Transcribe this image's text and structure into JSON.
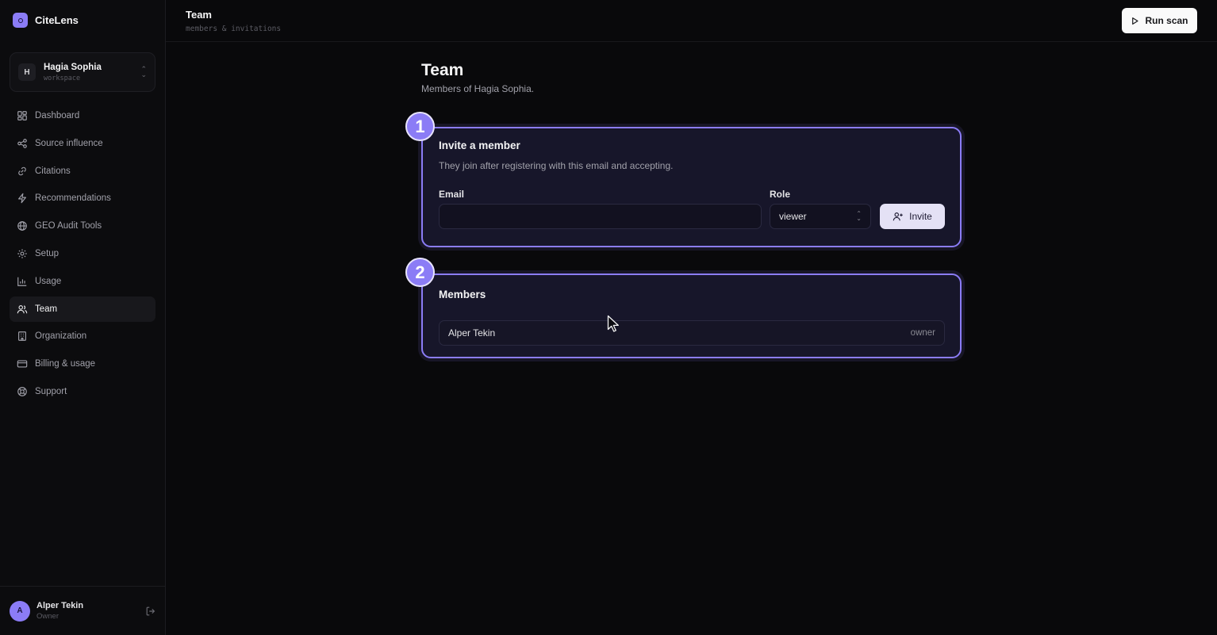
{
  "brand": {
    "name": "CiteLens"
  },
  "workspace": {
    "initial": "H",
    "name": "Hagia Sophia",
    "label": "workspace"
  },
  "nav": [
    {
      "label": "Dashboard",
      "icon": "dashboard-icon"
    },
    {
      "label": "Source influence",
      "icon": "share-nodes-icon"
    },
    {
      "label": "Citations",
      "icon": "link-icon"
    },
    {
      "label": "Recommendations",
      "icon": "lightning-icon"
    },
    {
      "label": "GEO Audit Tools",
      "icon": "globe-icon"
    },
    {
      "label": "Setup",
      "icon": "gear-icon"
    },
    {
      "label": "Usage",
      "icon": "bar-chart-icon"
    },
    {
      "label": "Team",
      "icon": "users-icon",
      "active": true
    },
    {
      "label": "Organization",
      "icon": "building-icon"
    },
    {
      "label": "Billing & usage",
      "icon": "credit-card-icon"
    },
    {
      "label": "Support",
      "icon": "lifebuoy-icon"
    }
  ],
  "user": {
    "initial": "A",
    "name": "Alper Tekin",
    "role": "Owner"
  },
  "header": {
    "title": "Team",
    "subtitle": "members & invitations",
    "run_label": "Run scan"
  },
  "page": {
    "title": "Team",
    "subtitle": "Members of Hagia Sophia."
  },
  "invite": {
    "step": "1",
    "title": "Invite a member",
    "description": "They join after registering with this email and accepting.",
    "email_label": "Email",
    "email_value": "",
    "role_label": "Role",
    "role_value": "viewer",
    "button_label": "Invite"
  },
  "members": {
    "step": "2",
    "title": "Members",
    "rows": [
      {
        "name": "Alper Tekin",
        "role": "owner"
      }
    ]
  },
  "colors": {
    "accent": "#8b7cf6",
    "background": "#09090b",
    "card": "#17162a"
  }
}
